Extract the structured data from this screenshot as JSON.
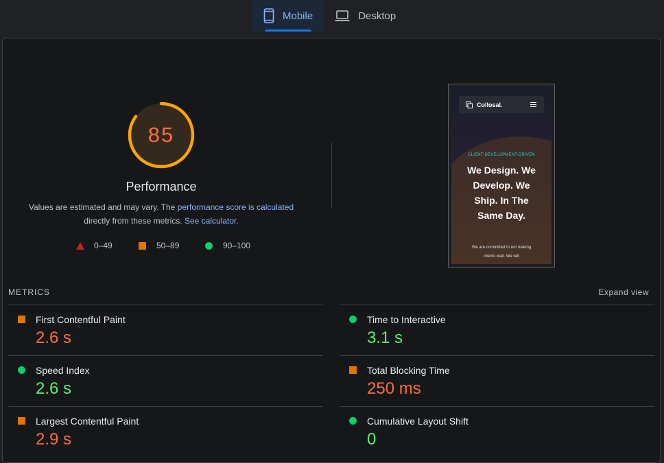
{
  "tabs": [
    {
      "label": "Mobile",
      "icon": "smartphone-icon",
      "active": true
    },
    {
      "label": "Desktop",
      "icon": "laptop-icon",
      "active": false
    }
  ],
  "summary": {
    "score": "85",
    "score_value": 0.85,
    "title": "Performance",
    "desc_prefix": "Values are estimated and may vary. The ",
    "desc_link": "performance score is calculated",
    "desc_mid": "directly from these metrics. ",
    "calc_link": "See calculator."
  },
  "legend": [
    {
      "label": "0–49",
      "shape": "triangle",
      "color": "#c5221f"
    },
    {
      "label": "50–89",
      "shape": "square",
      "color": "#e37400"
    },
    {
      "label": "90–100",
      "shape": "circle",
      "color": "#0cce6b"
    }
  ],
  "screenshot": {
    "brand": "Collosal.",
    "tagline": "CLIENT-DEVELOPMENT-DRIVEN",
    "headline": "We Design. We Develop. We Ship. In The Same Day.",
    "body": "We are committed to not making clients wait. We will"
  },
  "metrics_header": "METRICS",
  "expand_label": "Expand view",
  "metrics": [
    {
      "label": "First Contentful Paint",
      "value": "2.6 s",
      "rating": "average"
    },
    {
      "label": "Time to Interactive",
      "value": "3.1 s",
      "rating": "good"
    },
    {
      "label": "Speed Index",
      "value": "2.6 s",
      "rating": "good"
    },
    {
      "label": "Total Blocking Time",
      "value": "250 ms",
      "rating": "average"
    },
    {
      "label": "Largest Contentful Paint",
      "value": "2.9 s",
      "rating": "average"
    },
    {
      "label": "Cumulative Layout Shift",
      "value": "0",
      "rating": "good"
    }
  ],
  "colors": {
    "accent": "#8ab4f8",
    "tab_indicator": "#1a73e8",
    "fail": "#c5221f",
    "average": "#e37400",
    "pass": "#0cce6b",
    "gauge_orange": "#ffa400",
    "value_orange": "#ff6d3b",
    "value_green": "#57f26b"
  }
}
